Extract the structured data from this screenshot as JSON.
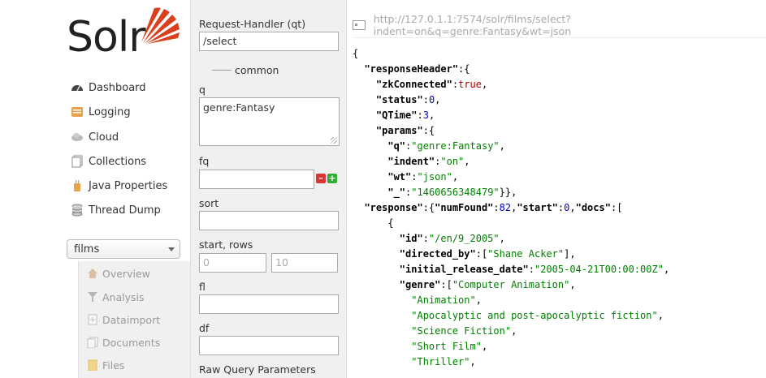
{
  "logo": {
    "text": "Solr"
  },
  "nav": {
    "items": [
      {
        "label": "Dashboard",
        "icon": "dashboard-icon"
      },
      {
        "label": "Logging",
        "icon": "logging-icon"
      },
      {
        "label": "Cloud",
        "icon": "cloud-icon"
      },
      {
        "label": "Collections",
        "icon": "collections-icon"
      },
      {
        "label": "Java Properties",
        "icon": "java-icon"
      },
      {
        "label": "Thread Dump",
        "icon": "thread-dump-icon"
      }
    ],
    "core_selector": {
      "selected": "films"
    },
    "core_menu": [
      {
        "label": "Overview",
        "icon": "overview-icon"
      },
      {
        "label": "Analysis",
        "icon": "analysis-icon"
      },
      {
        "label": "Dataimport",
        "icon": "dataimport-icon"
      },
      {
        "label": "Documents",
        "icon": "documents-icon"
      },
      {
        "label": "Files",
        "icon": "files-icon"
      }
    ]
  },
  "form": {
    "request_handler_label": "Request-Handler (qt)",
    "request_handler_value": "/select",
    "common_label": "common",
    "q_label": "q",
    "q_value": "genre:Fantasy",
    "fq_label": "fq",
    "fq_value": "",
    "sort_label": "sort",
    "sort_value": "",
    "start_rows_label": "start, rows",
    "start_placeholder": "0",
    "rows_placeholder": "10",
    "fl_label": "fl",
    "fl_value": "",
    "df_label": "df",
    "df_value": "",
    "raw_label": "Raw Query Parameters",
    "minus_glyph": "–",
    "plus_glyph": "+"
  },
  "response": {
    "url": "http://127.0.1.1:7574/solr/films/select?indent=on&q=genre:Fantasy&wt=json",
    "lines": [
      "{",
      "  \"responseHeader\":{",
      "    \"zkConnected\":true,",
      "    \"status\":0,",
      "    \"QTime\":3,",
      "    \"params\":{",
      "      \"q\":\"genre:Fantasy\",",
      "      \"indent\":\"on\",",
      "      \"wt\":\"json\",",
      "      \"_\":\"1460656348479\"}},",
      "  \"response\":{\"numFound\":82,\"start\":0,\"docs\":[",
      "      {",
      "        \"id\":\"/en/9_2005\",",
      "        \"directed_by\":[\"Shane Acker\"],",
      "        \"initial_release_date\":\"2005-04-21T00:00:00Z\",",
      "        \"genre\":[\"Computer Animation\",",
      "          \"Animation\",",
      "          \"Apocalyptic and post-apocalyptic fiction\",",
      "          \"Science Fiction\",",
      "          \"Short Film\",",
      "          \"Thriller\","
    ]
  }
}
